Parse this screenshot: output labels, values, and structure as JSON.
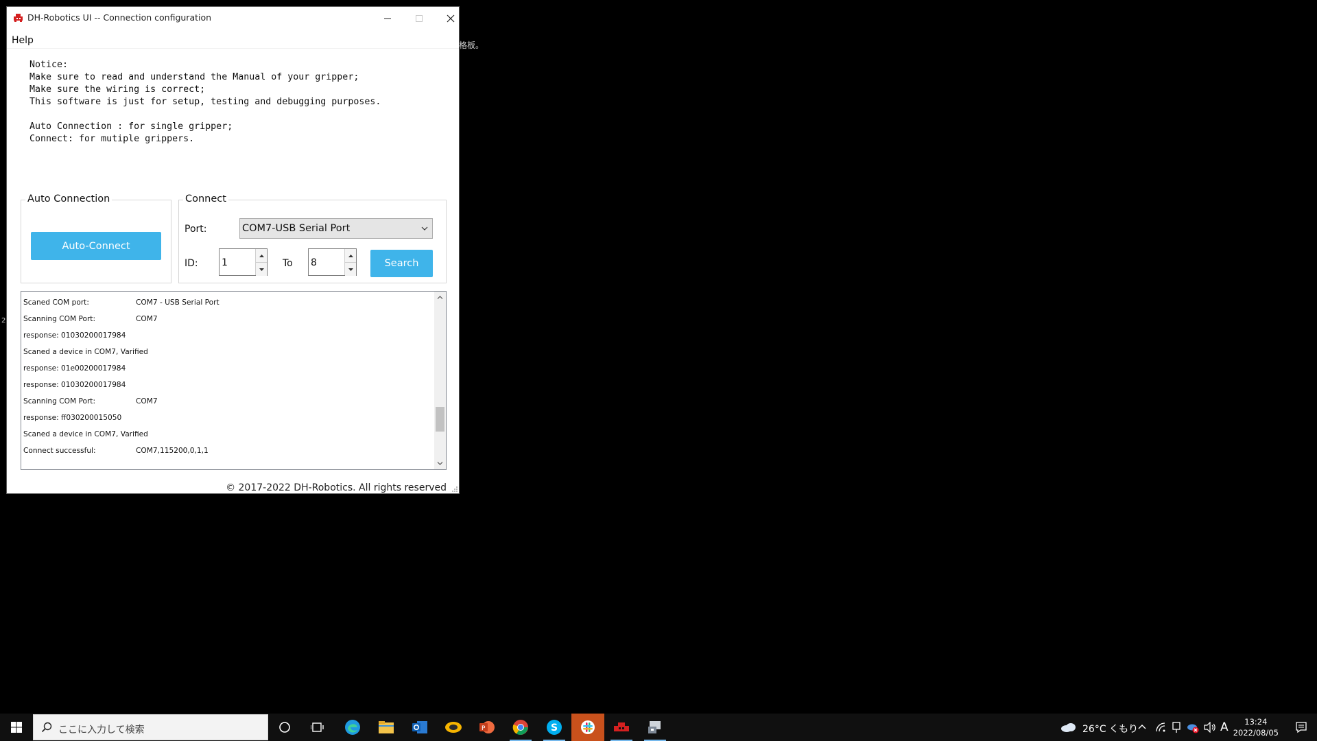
{
  "window": {
    "title": "DH-Robotics UI -- Connection configuration",
    "menu": {
      "help": "Help"
    },
    "notice_text": "Notice:\nMake sure to read and understand the Manual of your gripper;\nMake sure the wiring is correct;\nThis software is just for setup, testing and debugging purposes.\n\nAuto Connection : for single gripper;\nConnect: for mutiple grippers.",
    "auto_connection": {
      "group_title": "Auto Connection",
      "button_label": "Auto-Connect"
    },
    "connect": {
      "group_title": "Connect",
      "port_label": "Port:",
      "port_value": "COM7-USB Serial Port",
      "id_label": "ID:",
      "id_from": "1",
      "to_label": "To",
      "id_to": "8",
      "search_label": "Search"
    },
    "log": [
      {
        "key": "Scaned COM port:",
        "value": "COM7 - USB Serial Port"
      },
      {
        "key": "Scanning COM Port:",
        "value": "COM7"
      },
      {
        "key": "response: 01030200017984",
        "value": ""
      },
      {
        "key": "Scaned a device in COM7, Varified",
        "value": ""
      },
      {
        "key": "response: 01e00200017984",
        "value": ""
      },
      {
        "key": "response: 01030200017984",
        "value": ""
      },
      {
        "key": "Scanning COM Port:",
        "value": "COM7"
      },
      {
        "key": "response: ff030200015050",
        "value": ""
      },
      {
        "key": "Scaned a device in COM7, Varified",
        "value": ""
      },
      {
        "key": "Connect successful:",
        "value": "COM7,115200,0,1,1"
      }
    ],
    "copyright": "© 2017-2022 DH-Robotics. All rights reserved"
  },
  "desktop": {
    "fragment_right": "格板。",
    "fragment_left": "2"
  },
  "taskbar": {
    "search_placeholder": "ここに入力して検索",
    "weather": "26°C くもり",
    "ime": "A",
    "time": "13:24",
    "date": "2022/08/05"
  },
  "colors": {
    "accent_button": "#3fb4ea",
    "taskbar_bg": "#101010",
    "active_app_bg": "#c9511c"
  }
}
